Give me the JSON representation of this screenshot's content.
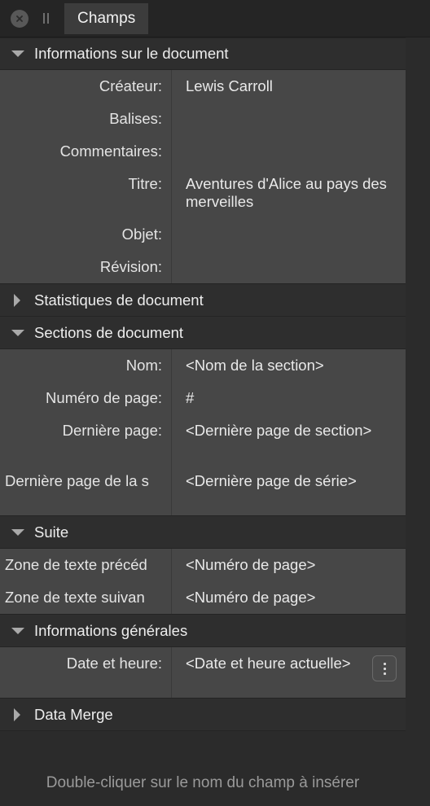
{
  "window": {
    "close_icon": "close-circle-icon",
    "grip_icon": "pause-grip-icon",
    "tab_label": "Champs"
  },
  "colors": {
    "window_bg": "#2b2b2b",
    "tabbar_bg": "#252525",
    "tab_active_bg": "#3c3c3c",
    "group_header_bg": "#2e2e2e",
    "row_bg": "#474747",
    "label_bg": "#464646",
    "text": "#e9e9e9",
    "muted_text": "#9a9a9a",
    "triangle": "#a9a9a9"
  },
  "groups": [
    {
      "name": "document-information",
      "label": "Informations sur le document",
      "expanded": true,
      "triangle": "triangle-down-icon",
      "rows": [
        {
          "label": "Créateur:",
          "value": "Lewis Carroll",
          "tall": false,
          "clipped": false
        },
        {
          "label": "Balises:",
          "value": "",
          "tall": false,
          "clipped": false
        },
        {
          "label": "Commentaires:",
          "value": "",
          "tall": false,
          "clipped": false
        },
        {
          "label": "Titre:",
          "value": "Aventures d'Alice au pays des merveilles",
          "tall": true,
          "clipped": false
        },
        {
          "label": "Objet:",
          "value": "",
          "tall": false,
          "clipped": false
        },
        {
          "label": "Révision:",
          "value": "",
          "tall": false,
          "clipped": false
        }
      ]
    },
    {
      "name": "document-statistics",
      "label": "Statistiques de document",
      "expanded": false,
      "triangle": "triangle-right-icon",
      "rows": []
    },
    {
      "name": "document-sections",
      "label": "Sections de document",
      "expanded": true,
      "triangle": "triangle-down-icon",
      "rows": [
        {
          "label": "Nom:",
          "value": "<Nom de la section>",
          "tall": false,
          "clipped": false
        },
        {
          "label": "Numéro de page:",
          "value": "#",
          "tall": false,
          "clipped": false
        },
        {
          "label": "Dernière page:",
          "value": "<Dernière page de section>",
          "tall": true,
          "clipped": false
        },
        {
          "label": "Dernière page de la s",
          "value": "<Dernière page de série>",
          "tall": true,
          "clipped": true
        }
      ]
    },
    {
      "name": "continuation",
      "label": "Suite",
      "expanded": true,
      "triangle": "triangle-down-icon",
      "rows": [
        {
          "label": "Zone de texte précéd",
          "value": "<Numéro de page>",
          "tall": false,
          "clipped": true
        },
        {
          "label": "Zone de texte suivan",
          "value": "<Numéro de page>",
          "tall": false,
          "clipped": true
        }
      ]
    },
    {
      "name": "general-information",
      "label": "Informations générales",
      "expanded": true,
      "triangle": "triangle-down-icon",
      "rows": [
        {
          "label": "Date et heure:",
          "value": "<Date et heure actuelle>",
          "tall": true,
          "clipped": false,
          "kebab": "more-options-icon"
        }
      ]
    },
    {
      "name": "data-merge",
      "label": "Data Merge",
      "expanded": false,
      "triangle": "triangle-right-icon",
      "rows": []
    }
  ],
  "footer": {
    "hint": "Double-cliquer sur le nom du champ à insérer"
  }
}
